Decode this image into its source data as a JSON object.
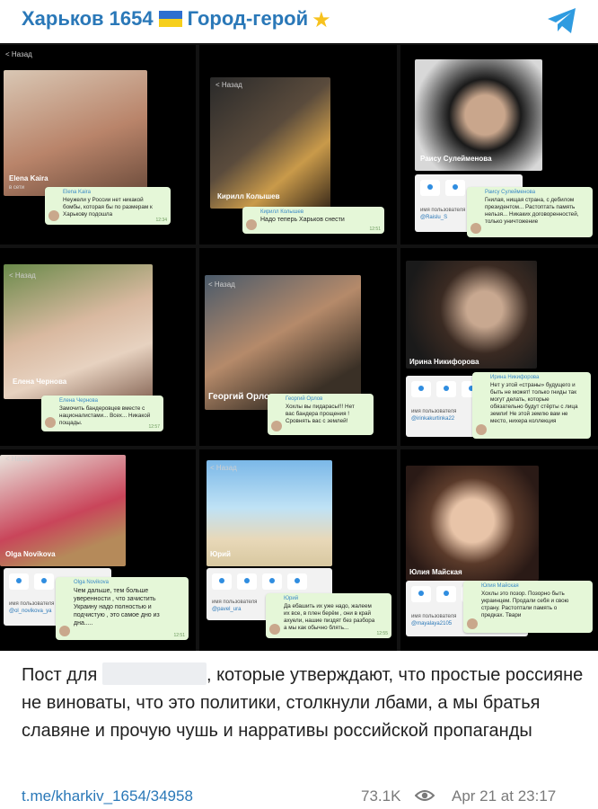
{
  "header": {
    "title_part1": "Харьков 1654",
    "title_part2": "Город-герой",
    "share_icon": "telegram-icon"
  },
  "colors": {
    "accent": "#2a78b8",
    "bubble": "#e5f7d8",
    "collage_bg": "#121212"
  },
  "tiles": [
    {
      "back": "< Назад",
      "name": "Elena Kaira",
      "status": "в сети",
      "user_label": "",
      "username": "",
      "msg_sender": "Elena Kaira",
      "msg_text": "Неужели у России нет никакой бомбы, которая бы по размерам к Харькову подошла",
      "msg_time": "12:34"
    },
    {
      "back": "< Назад",
      "name": "Кирилл Колышев",
      "status": "",
      "user_label": "",
      "username": "",
      "msg_sender": "Кирилл Колышев",
      "msg_text": "Надо теперь Харьков снести",
      "msg_time": "12:51"
    },
    {
      "back": "",
      "name": "Раису Сулейменова",
      "status": "",
      "user_label": "имя пользователя",
      "username": "@Raislu_S",
      "msg_sender": "Раису Сулейменова",
      "msg_text": "Гнилая, нищая страна, с дебилом президентом... Растоптать память нельзя... Никаких договоренностей, только уничтожение",
      "msg_time": ""
    },
    {
      "back": "< Назад",
      "name": "Елена Чернова",
      "status": "",
      "user_label": "",
      "username": "",
      "msg_sender": "Елена Чернова",
      "msg_text": "Замочить бандеровцев вместе с националистами... Всех... Никакой пощады.",
      "msg_time": "12:57"
    },
    {
      "back": "< Назад",
      "name": "Георгий Орлов",
      "status": "",
      "user_label": "",
      "username": "",
      "msg_sender": "Георгий Орлов",
      "msg_text": "Хохлы вы пидарасы!!! Нет вас бандера прощения ! Сровнять вас с землей!",
      "msg_time": ""
    },
    {
      "back": "",
      "name": "Ирина Никифорова",
      "status": "",
      "user_label": "имя пользователя",
      "username": "@irinkakurtinka22",
      "msg_sender": "Ирина Никифорова",
      "msg_text": "Нет у этой «страны» будущего и быть не может! только гниды так могут делать, которые обязательно будут стёрты с лица земли! Не этой землю вам не место, нихера коллекция",
      "msg_time": ""
    },
    {
      "back": "< Назад",
      "name": "Olga Novikova",
      "status": "",
      "user_label": "имя пользователя",
      "username": "@ol_novikova_ya",
      "msg_sender": "Olga Novikova",
      "msg_text": "Чем дальше, тем больше уверенности , что зачистить Украину надо полностью и подчистую , это самое дно из дна.....",
      "msg_time": "12:51"
    },
    {
      "back": "< Назад",
      "name": "Юрий",
      "status": "",
      "user_label": "имя пользователя",
      "username": "@pavel_ura",
      "msg_sender": "Юрий",
      "msg_text": "Да ебашить их уже надо, жалеем их все, в плен берём , они в край ахуели, нашие пиздят без разбора а мы как обычно блять...",
      "msg_time": "12:55"
    },
    {
      "back": "",
      "name": "Юлия Майская",
      "status": "",
      "user_label": "имя пользователя",
      "username": "@mayalaya2105",
      "msg_sender": "Юлия Майская",
      "msg_text": "Хохлы это позор. Позорно быть украинцем. Продали себя и свою страну. Растоптали память о предках. Твари",
      "msg_time": ""
    }
  ],
  "post": {
    "text_before": "Пост для",
    "text_after": ", которые утверждают, что простые россияне не виноваты, что это политики, столкнули лбами, а мы братья славяне и прочую чушь и нарративы российской пропаганды",
    "link": "t.me/kharkiv_1654/34958",
    "views": "73.1K",
    "date": "Apr 21 at 23:17"
  }
}
